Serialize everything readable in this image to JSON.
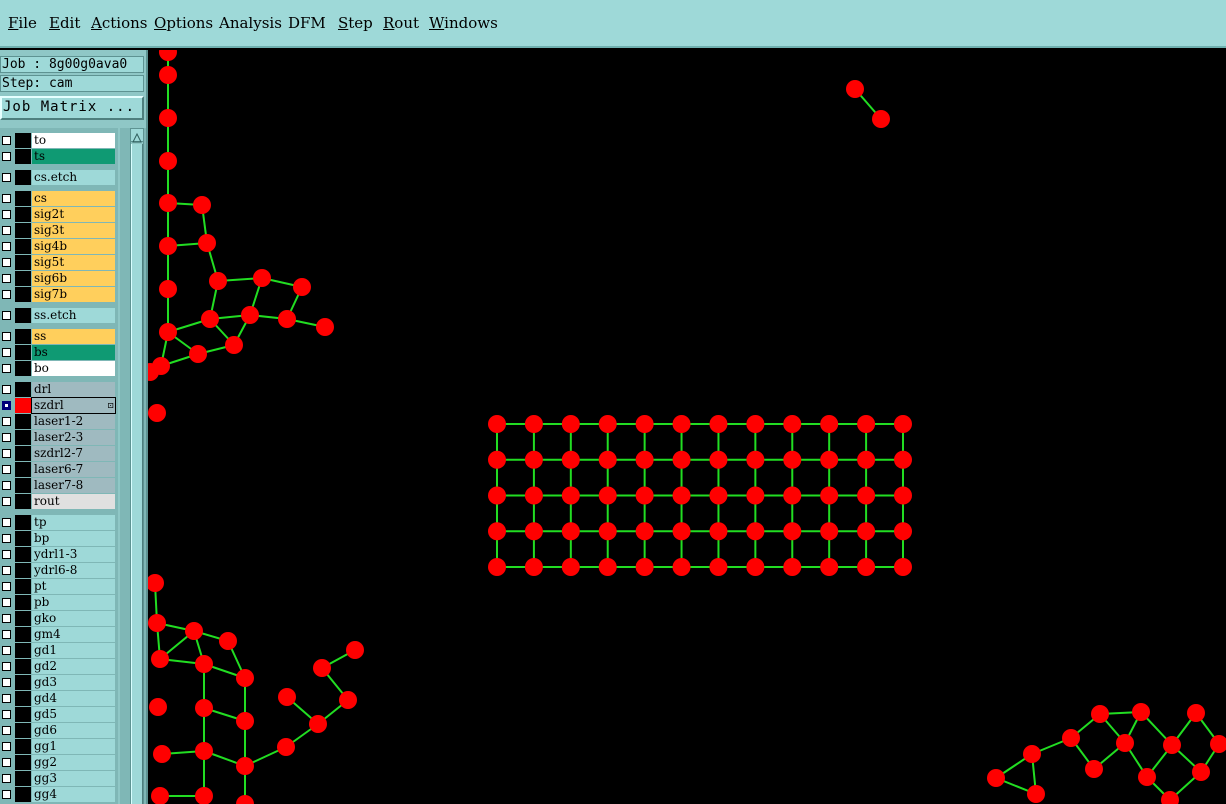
{
  "menubar": {
    "items": [
      {
        "mnemonic": "F",
        "rest": "ile"
      },
      {
        "mnemonic": "E",
        "rest": "dit"
      },
      {
        "mnemonic": "A",
        "rest": "ctions"
      },
      {
        "mnemonic": "O",
        "rest": "ptions"
      },
      {
        "mnemonic": "",
        "rest": "Analysis"
      },
      {
        "mnemonic": "",
        "rest": "DFM"
      },
      {
        "mnemonic": "S",
        "rest": "tep"
      },
      {
        "mnemonic": "R",
        "rest": "out"
      },
      {
        "mnemonic": "W",
        "rest": "indows"
      }
    ]
  },
  "info": {
    "job": "Job : 8g00g0ava0",
    "step": "Step: cam"
  },
  "job_matrix_label": "Job Matrix ...",
  "colors": {
    "menubar_bg": "#9ed9d8",
    "white_layer": "#ffffff",
    "mask_layer": "#0f9a73",
    "etch_layer": "#9ed9d8",
    "signal_layer": "#ffcf5c",
    "drill_layer": "#9fbac0",
    "rout_layer": "#e0e0e0",
    "aux_layer": "#9ed9d8",
    "pad_red": "#ff0000",
    "net_green": "#22dd22"
  },
  "layers": [
    {
      "name": "to",
      "color": "white_layer"
    },
    {
      "name": "ts",
      "color": "mask_layer"
    },
    {
      "name": "cs.etch",
      "color": "etch_layer"
    },
    {
      "name": "cs",
      "color": "signal_layer"
    },
    {
      "name": "sig2t",
      "color": "signal_layer"
    },
    {
      "name": "sig3t",
      "color": "signal_layer"
    },
    {
      "name": "sig4b",
      "color": "signal_layer"
    },
    {
      "name": "sig5t",
      "color": "signal_layer"
    },
    {
      "name": "sig6b",
      "color": "signal_layer"
    },
    {
      "name": "sig7b",
      "color": "signal_layer"
    },
    {
      "name": "ss.etch",
      "color": "etch_layer"
    },
    {
      "name": "ss",
      "color": "signal_layer"
    },
    {
      "name": "bs",
      "color": "mask_layer"
    },
    {
      "name": "bo",
      "color": "white_layer"
    },
    {
      "name": "drl",
      "color": "drill_layer"
    },
    {
      "name": "szdrl",
      "color": "drill_layer",
      "checked": true,
      "swatch": "pad_red",
      "active": true,
      "mark": "⊡"
    },
    {
      "name": "laser1-2",
      "color": "drill_layer"
    },
    {
      "name": "laser2-3",
      "color": "drill_layer"
    },
    {
      "name": "szdrl2-7",
      "color": "drill_layer"
    },
    {
      "name": "laser6-7",
      "color": "drill_layer"
    },
    {
      "name": "laser7-8",
      "color": "drill_layer"
    },
    {
      "name": "rout",
      "color": "rout_layer"
    },
    {
      "name": "tp",
      "color": "aux_layer"
    },
    {
      "name": "bp",
      "color": "aux_layer"
    },
    {
      "name": "ydrl1-3",
      "color": "aux_layer"
    },
    {
      "name": "ydrl6-8",
      "color": "aux_layer"
    },
    {
      "name": "pt",
      "color": "aux_layer"
    },
    {
      "name": "pb",
      "color": "aux_layer"
    },
    {
      "name": "gko",
      "color": "aux_layer"
    },
    {
      "name": "gm4",
      "color": "aux_layer"
    },
    {
      "name": "gd1",
      "color": "aux_layer"
    },
    {
      "name": "gd2",
      "color": "aux_layer"
    },
    {
      "name": "gd3",
      "color": "aux_layer"
    },
    {
      "name": "gd4",
      "color": "aux_layer"
    },
    {
      "name": "gd5",
      "color": "aux_layer"
    },
    {
      "name": "gd6",
      "color": "aux_layer"
    },
    {
      "name": "gg1",
      "color": "aux_layer"
    },
    {
      "name": "gg2",
      "color": "aux_layer"
    },
    {
      "name": "gg3",
      "color": "aux_layer"
    },
    {
      "name": "gg4",
      "color": "aux_layer"
    }
  ],
  "graphics": {
    "grid_columns": 12,
    "grid_rows": 5
  }
}
